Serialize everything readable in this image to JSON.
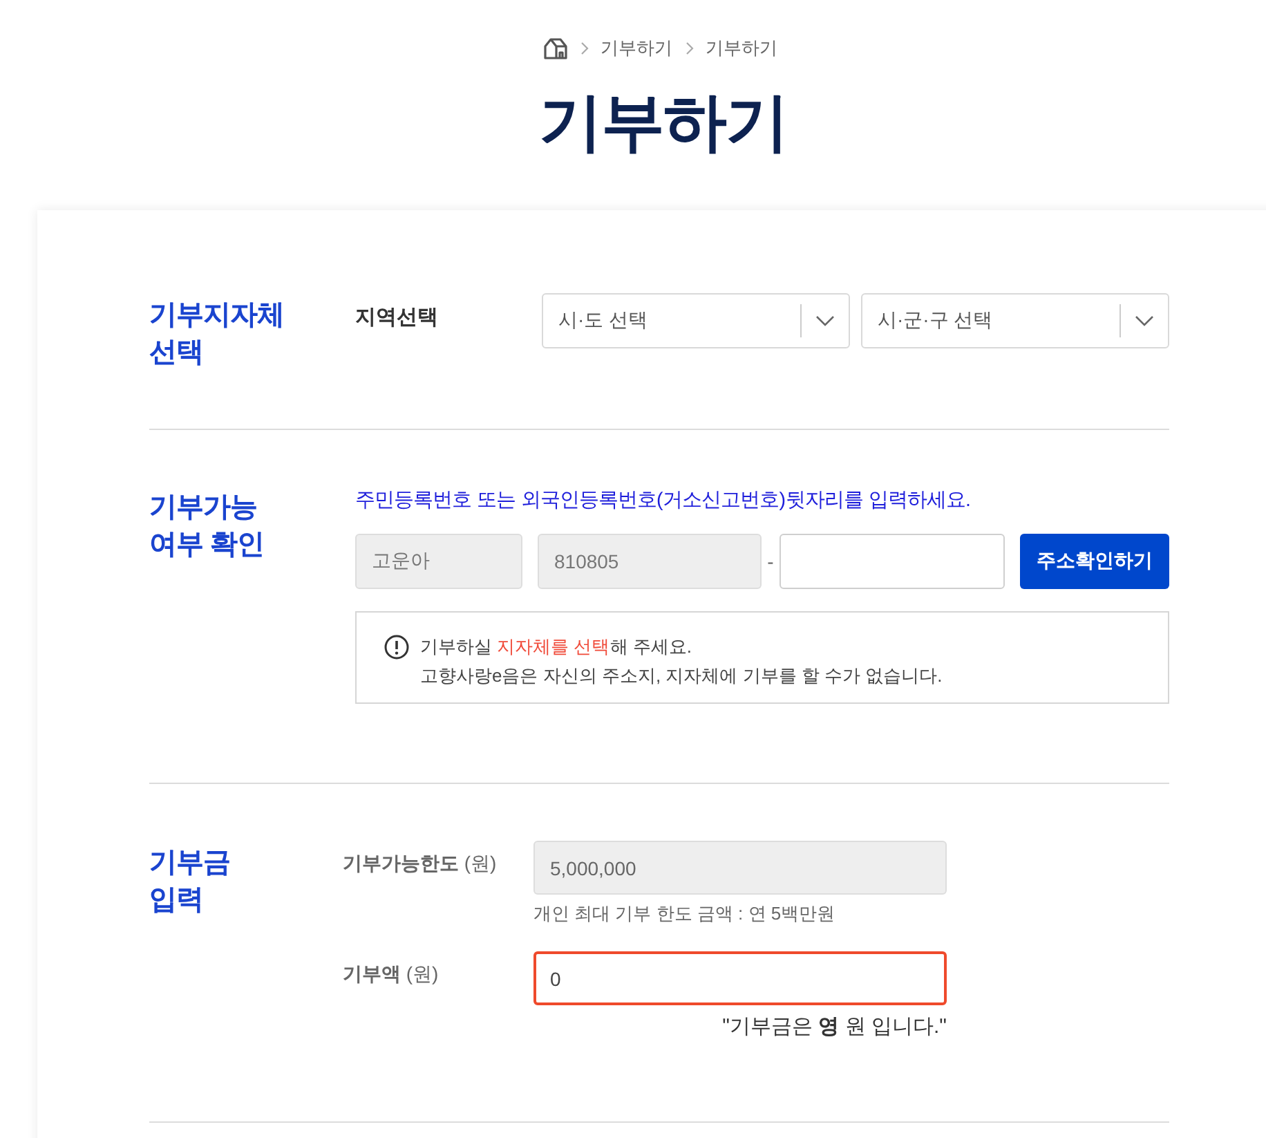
{
  "breadcrumb": {
    "items": [
      "기부하기",
      "기부하기"
    ]
  },
  "title": "기부하기",
  "sections": [
    {
      "kind": "region",
      "heading": [
        "기부지자체",
        "선택"
      ],
      "label": "지역선택",
      "selects": [
        {
          "text": "시·도 선택"
        },
        {
          "text": "시·군·구 선택"
        }
      ]
    },
    {
      "kind": "verify",
      "heading": [
        "기부가능",
        "여부 확인"
      ],
      "instruction": "주민등록번호 또는 외국인등록번호(거소신고번호)뒷자리를 입력하세요.",
      "fields": [
        {
          "value": "고운아",
          "disabled": true
        },
        {
          "value": "810805",
          "disabled": true
        },
        {
          "prefix": "-",
          "disabled": false
        }
      ],
      "button": "주소확인하기",
      "notice": {
        "first_line": [
          {
            "text": "기부하실 ",
            "emphasis": false
          },
          {
            "text": "지자체를 선택",
            "emphasis": true
          },
          {
            "text": "해 주세요.",
            "emphasis": false
          }
        ],
        "second_line": "고향사랑e음은 자신의 주소지, 지자체에 기부를 할 수가 없습니다."
      }
    },
    {
      "kind": "amount",
      "heading": [
        "기부금",
        "입력"
      ],
      "rows": [
        {
          "label": "**기부가능한도** (원)",
          "value": "5,000,000",
          "disabled": true,
          "invalid": false,
          "help": "개인 최대 기부 한도 금액 : 연 5백만원"
        },
        {
          "label": "**기부액** (원)",
          "value": "0",
          "disabled": false,
          "invalid": true
        }
      ],
      "summary": "\"기부금은 **영** 원 입니다.\""
    }
  ]
}
